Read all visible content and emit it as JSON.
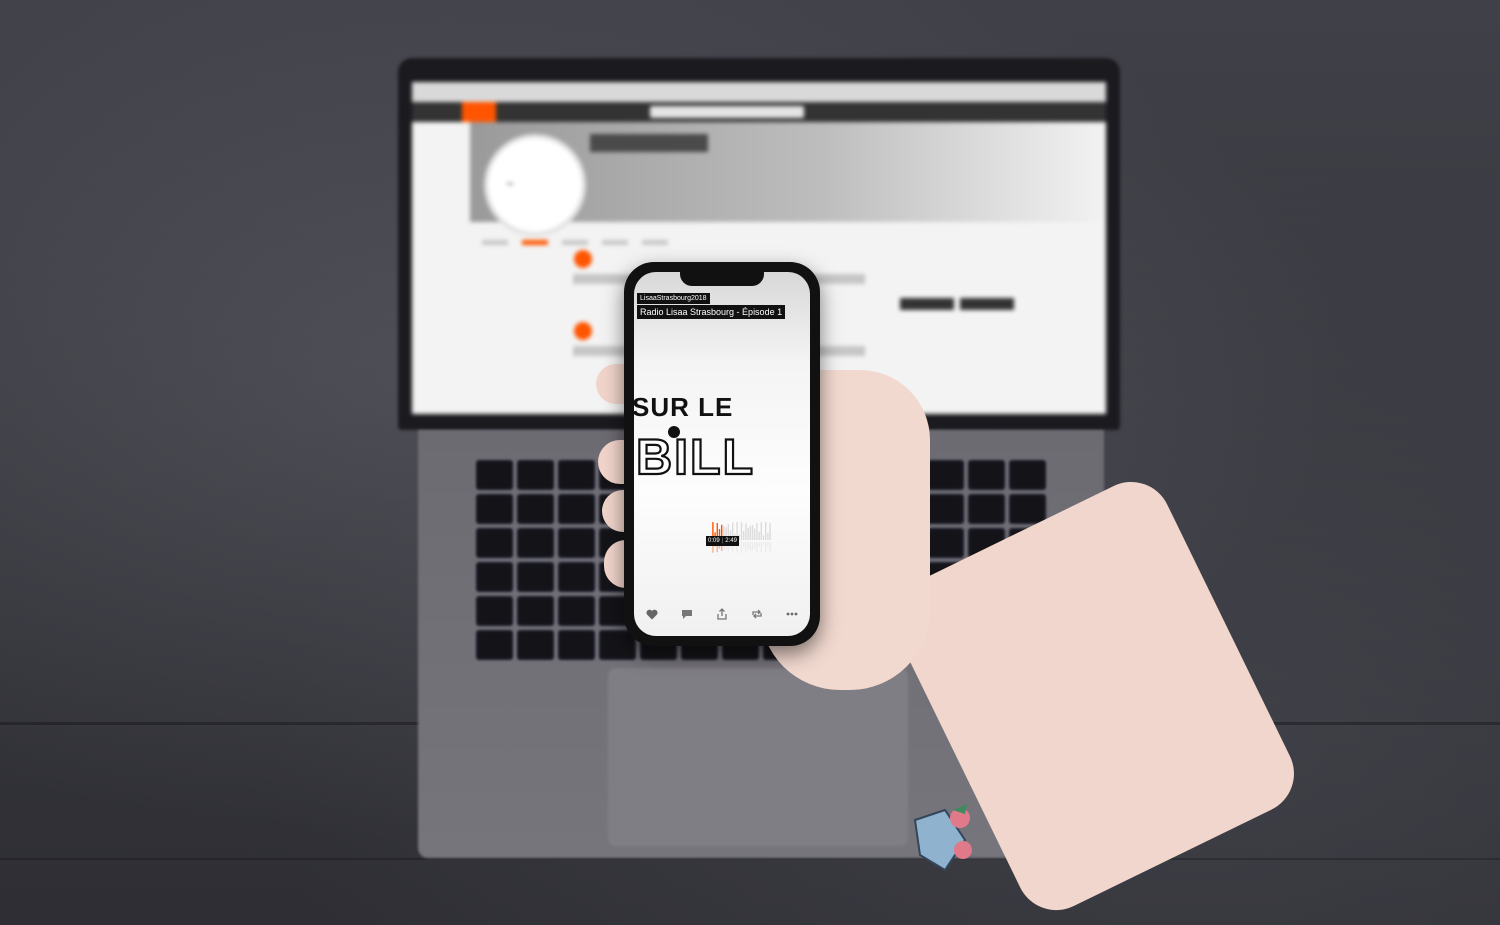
{
  "phone": {
    "artist": "LisaaStrasbourg2018",
    "track_title": "Radio Lisaa Strasbourg - Épisode 1",
    "artwork": {
      "line1": "SUR LE",
      "line2": "BILL"
    },
    "player": {
      "elapsed": "0:09",
      "duration": "2:49",
      "progress": 0.053
    },
    "actions": {
      "like_icon": "heart-icon",
      "comment_icon": "comment-icon",
      "share_icon": "share-icon",
      "repost_icon": "repost-icon",
      "more_icon": "more-icon"
    }
  },
  "colors": {
    "accent": "#ff5500",
    "tag_bg": "#111111",
    "tag_text": "#ffffff"
  }
}
